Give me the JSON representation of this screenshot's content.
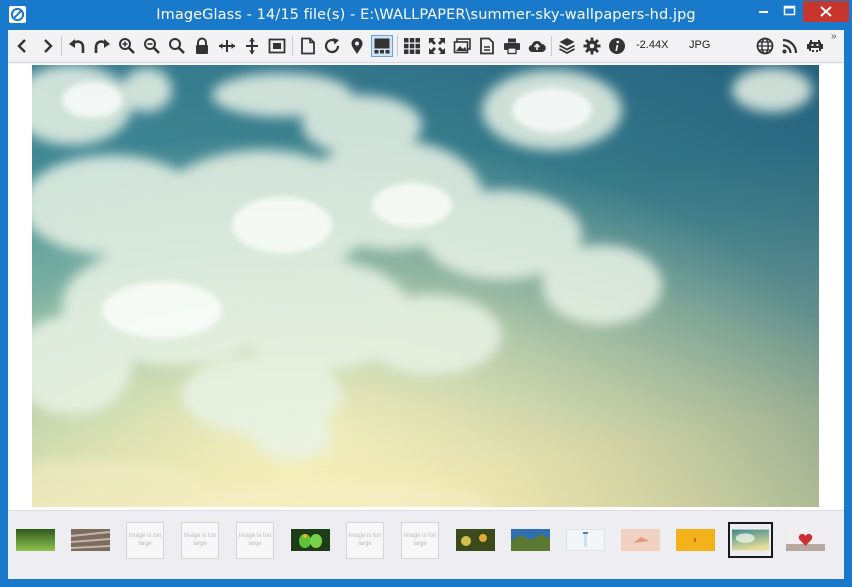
{
  "window": {
    "title": "ImageGlass - 14/15 file(s) - E:\\WALLPAPER\\summer-sky-wallpapers-hd.jpg",
    "controls": [
      "minimize",
      "maximize",
      "close"
    ]
  },
  "toolbar": {
    "zoom_value": "-2.44X",
    "format": "JPG",
    "icons": [
      "previous-image-icon",
      "next-image-icon",
      "rotate-left-icon",
      "rotate-right-icon",
      "zoom-in-icon",
      "zoom-out-icon",
      "actual-size-icon",
      "zoom-lock-icon",
      "scale-to-width-icon",
      "scale-to-height-icon",
      "auto-zoom-icon",
      "open-file-icon",
      "refresh-icon",
      "goto-image-icon",
      "thumbnail-bar-icon",
      "checkerboard-icon",
      "fullscreen-icon",
      "slideshow-icon",
      "convert-icon",
      "print-icon",
      "upload-icon",
      "extension-manager-icon",
      "settings-icon",
      "about-icon",
      "language-icon",
      "rss-icon",
      "report-bug-icon"
    ],
    "overflow_label": "»"
  },
  "thumbnails": [
    {
      "name": "thumb-grass",
      "kind": "image",
      "colors": [
        "#2f5a1e",
        "#7fb24a"
      ]
    },
    {
      "name": "thumb-wood",
      "kind": "image",
      "colors": [
        "#6a5a50",
        "#b8a596"
      ]
    },
    {
      "name": "thumb-placeholder-1",
      "kind": "placeholder",
      "text": "Image is too large"
    },
    {
      "name": "thumb-placeholder-2",
      "kind": "placeholder",
      "text": "Image is too large"
    },
    {
      "name": "thumb-placeholder-3",
      "kind": "placeholder",
      "text": "Image is too large"
    },
    {
      "name": "thumb-parrots",
      "kind": "image",
      "colors": [
        "#1d3d18",
        "#5cc43a"
      ]
    },
    {
      "name": "thumb-placeholder-4",
      "kind": "placeholder",
      "text": "Image is too large"
    },
    {
      "name": "thumb-placeholder-5",
      "kind": "placeholder",
      "text": "Image is too large"
    },
    {
      "name": "thumb-flowers",
      "kind": "image",
      "colors": [
        "#3b4a1a",
        "#d4c04a"
      ]
    },
    {
      "name": "thumb-landscape",
      "kind": "image",
      "colors": [
        "#2f6fb0",
        "#6b8a3a"
      ]
    },
    {
      "name": "thumb-lighthouse",
      "kind": "image",
      "colors": [
        "#f3f6f8",
        "#cfe3ee"
      ]
    },
    {
      "name": "thumb-pink-bird",
      "kind": "image",
      "colors": [
        "#f1d2c2",
        "#e39a7a"
      ]
    },
    {
      "name": "thumb-orange",
      "kind": "image",
      "colors": [
        "#f4b21a",
        "#e88f0e"
      ]
    },
    {
      "name": "thumb-summer-sky",
      "kind": "image",
      "selected": true,
      "colors": [
        "#cfe1d8",
        "#3c8a8c"
      ]
    },
    {
      "name": "thumb-heart",
      "kind": "image",
      "colors": [
        "#c93030",
        "#f0f0f0"
      ]
    }
  ],
  "colors": {
    "titlebar": "#1979ca",
    "close_button": "#c7362c",
    "toolbar_bg": "#f2f2f5",
    "sky_top": "#2a6c88",
    "sky_bottom": "#e6d89a"
  }
}
